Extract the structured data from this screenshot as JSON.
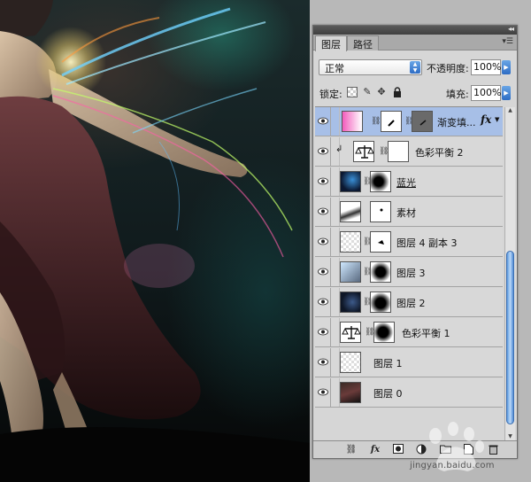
{
  "panel": {
    "tabs": [
      {
        "label": "图层",
        "active": true
      },
      {
        "label": "路径",
        "active": false
      }
    ],
    "menu_icon": "panel-menu-icon",
    "blend_mode": {
      "value": "正常"
    },
    "opacity": {
      "label": "不透明度:",
      "value": "100%"
    },
    "lock": {
      "label": "锁定:",
      "icons": [
        "lock-transparent-icon",
        "lock-brush-icon",
        "lock-move-icon",
        "lock-all-icon"
      ]
    },
    "fill": {
      "label": "填充:",
      "value": "100%"
    }
  },
  "layers": [
    {
      "name": "渐变填...",
      "selected": true,
      "fx": "fx"
    },
    {
      "name": "色彩平衡 2",
      "selected": false
    },
    {
      "name": "蓝光",
      "selected": false
    },
    {
      "name": "素材",
      "selected": false
    },
    {
      "name": "图层 4 副本 3",
      "selected": false
    },
    {
      "name": "图层 3",
      "selected": false
    },
    {
      "name": "图层 2",
      "selected": false
    },
    {
      "name": "色彩平衡 1",
      "selected": false
    },
    {
      "name": "图层 1",
      "selected": false
    },
    {
      "name": "图层 0",
      "selected": false
    }
  ],
  "toolbar": {
    "fx_label": "fx",
    "icons": [
      "link-layers-icon",
      "fx-icon",
      "add-mask-icon",
      "adjustment-layer-icon",
      "new-group-icon",
      "new-layer-icon",
      "trash-icon"
    ]
  },
  "colors": {
    "selected_row": "#a7bfe7",
    "scroll_thumb": "#5d9be0",
    "panel_bg": "#d6d6d6"
  },
  "watermark": {
    "text": "jingyan.baidu.com"
  }
}
